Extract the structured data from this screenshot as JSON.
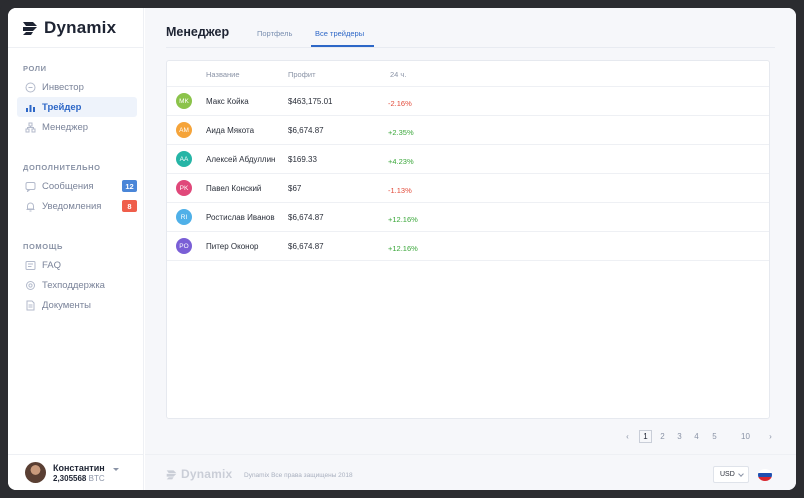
{
  "app": {
    "brand": "Dynamix"
  },
  "sidebar": {
    "sections": [
      {
        "title": "РОЛИ",
        "items": [
          {
            "label": "Инвестор",
            "icon": "investor-icon",
            "active": false
          },
          {
            "label": "Трейдер",
            "icon": "chart-icon",
            "active": true
          },
          {
            "label": "Менеджер",
            "icon": "org-icon",
            "active": false
          }
        ]
      },
      {
        "title": "ДОПОЛНИТЕЛЬНО",
        "items": [
          {
            "label": "Сообщения",
            "icon": "message-icon",
            "badge": "12",
            "badge_color": "#4a86d8"
          },
          {
            "label": "Уведомления",
            "icon": "bell-icon",
            "badge": "8",
            "badge_color": "#ef5e4b"
          }
        ]
      },
      {
        "title": "ПОМОЩЬ",
        "items": [
          {
            "label": "FAQ",
            "icon": "faq-icon"
          },
          {
            "label": "Техподдержка",
            "icon": "support-icon"
          },
          {
            "label": "Документы",
            "icon": "document-icon"
          }
        ]
      }
    ]
  },
  "user": {
    "name": "Константин",
    "balance": "2,305568",
    "currency": "BTC"
  },
  "main": {
    "title": "Менеджер",
    "tabs": [
      {
        "label": "Портфель",
        "active": false
      },
      {
        "label": "Все трейдеры",
        "active": true
      }
    ],
    "table": {
      "columns": [
        "Название",
        "Профит",
        "24 ч."
      ],
      "rows": [
        {
          "initials": "MK",
          "color": "#8bc34a",
          "name": "Макс Койка",
          "profit": "$463,175.01",
          "change": "-2.16%",
          "trend": "neg"
        },
        {
          "initials": "AM",
          "color": "#f5a43a",
          "name": "Аида Мякота",
          "profit": "$6,674.87",
          "change": "+2.35%",
          "trend": "pos"
        },
        {
          "initials": "AA",
          "color": "#26b5a6",
          "name": "Алексей Абдуллин",
          "profit": "$169.33",
          "change": "+4.23%",
          "trend": "pos"
        },
        {
          "initials": "PK",
          "color": "#e0487a",
          "name": "Павел Конский",
          "profit": "$67",
          "change": "-1.13%",
          "trend": "neg"
        },
        {
          "initials": "RI",
          "color": "#4fb0e8",
          "name": "Ростислав Иванов",
          "profit": "$6,674.87",
          "change": "+12.16%",
          "trend": "pos"
        },
        {
          "initials": "PO",
          "color": "#7a5fd6",
          "name": "Питер Оконор",
          "profit": "$6,674.87",
          "change": "+12.16%",
          "trend": "pos"
        }
      ]
    },
    "pagination": {
      "prev": "‹",
      "pages": [
        "1",
        "2",
        "3",
        "4",
        "5"
      ],
      "last": "10",
      "next": "›",
      "current": "1"
    }
  },
  "footer": {
    "brand": "Dynamix",
    "copyright": "Dynamix Все права защищены 2018",
    "currency": "USD",
    "language_flag": "russia-flag-icon"
  }
}
